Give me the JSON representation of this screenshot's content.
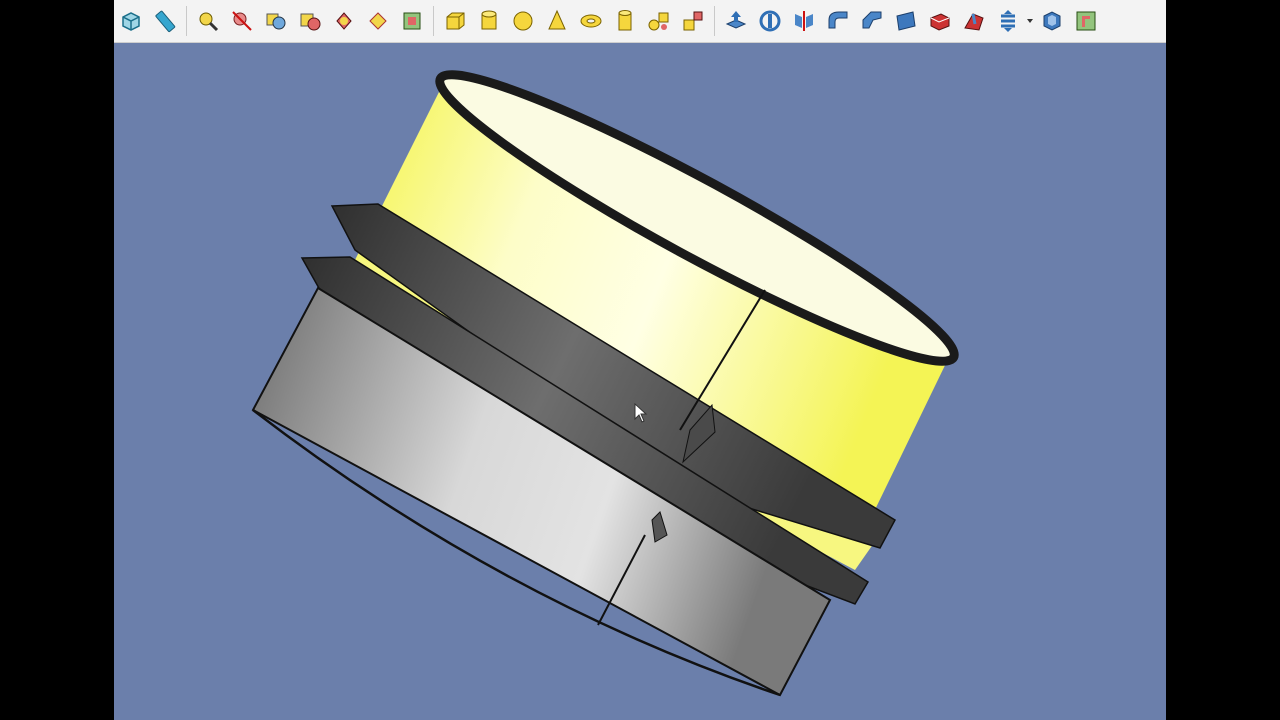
{
  "colors": {
    "viewport_bg": "#6b7fab",
    "part_yellow": "#f4f46a",
    "part_grey": "#bdbdbd",
    "edge": "#111111",
    "toolbar_bg": "#f3f3f3"
  },
  "toolbar": {
    "groups": [
      {
        "name": "measure",
        "icons": [
          "view-box-icon",
          "measure-ruler-icon"
        ]
      },
      {
        "name": "part-check",
        "icons": [
          "check-geometry-icon",
          "refine-shape-icon",
          "boolean-icon",
          "cut-icon",
          "common-icon",
          "union-icon",
          "section-icon"
        ]
      },
      {
        "name": "primitives",
        "icons": [
          "cube-icon",
          "cylinder-icon",
          "sphere-icon",
          "cone-icon",
          "torus-icon",
          "tube-icon",
          "primitives-icon",
          "shape-builder-icon"
        ]
      },
      {
        "name": "part-tools",
        "icons": [
          "extrude-icon",
          "revolve-icon",
          "mirror-icon",
          "fillet-icon",
          "chamfer-icon",
          "face-from-edges-icon",
          "ruled-surface-icon",
          "loft-icon",
          "sweep-icon",
          "thickness-icon",
          "offset-icon"
        ]
      }
    ]
  },
  "viewport": {
    "object": "3d-part-view"
  }
}
